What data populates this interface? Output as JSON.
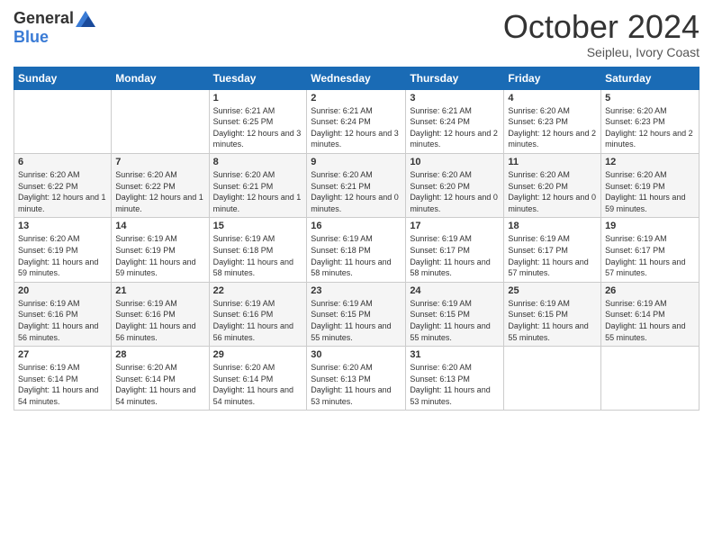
{
  "logo": {
    "general": "General",
    "blue": "Blue"
  },
  "header": {
    "title": "October 2024",
    "subtitle": "Seipleu, Ivory Coast"
  },
  "weekdays": [
    "Sunday",
    "Monday",
    "Tuesday",
    "Wednesday",
    "Thursday",
    "Friday",
    "Saturday"
  ],
  "weeks": [
    [
      null,
      null,
      {
        "day": 1,
        "sunrise": "6:21 AM",
        "sunset": "6:25 PM",
        "daylight": "12 hours and 3 minutes."
      },
      {
        "day": 2,
        "sunrise": "6:21 AM",
        "sunset": "6:24 PM",
        "daylight": "12 hours and 3 minutes."
      },
      {
        "day": 3,
        "sunrise": "6:21 AM",
        "sunset": "6:24 PM",
        "daylight": "12 hours and 2 minutes."
      },
      {
        "day": 4,
        "sunrise": "6:20 AM",
        "sunset": "6:23 PM",
        "daylight": "12 hours and 2 minutes."
      },
      {
        "day": 5,
        "sunrise": "6:20 AM",
        "sunset": "6:23 PM",
        "daylight": "12 hours and 2 minutes."
      }
    ],
    [
      {
        "day": 6,
        "sunrise": "6:20 AM",
        "sunset": "6:22 PM",
        "daylight": "12 hours and 1 minute."
      },
      {
        "day": 7,
        "sunrise": "6:20 AM",
        "sunset": "6:22 PM",
        "daylight": "12 hours and 1 minute."
      },
      {
        "day": 8,
        "sunrise": "6:20 AM",
        "sunset": "6:21 PM",
        "daylight": "12 hours and 1 minute."
      },
      {
        "day": 9,
        "sunrise": "6:20 AM",
        "sunset": "6:21 PM",
        "daylight": "12 hours and 0 minutes."
      },
      {
        "day": 10,
        "sunrise": "6:20 AM",
        "sunset": "6:20 PM",
        "daylight": "12 hours and 0 minutes."
      },
      {
        "day": 11,
        "sunrise": "6:20 AM",
        "sunset": "6:20 PM",
        "daylight": "12 hours and 0 minutes."
      },
      {
        "day": 12,
        "sunrise": "6:20 AM",
        "sunset": "6:19 PM",
        "daylight": "11 hours and 59 minutes."
      }
    ],
    [
      {
        "day": 13,
        "sunrise": "6:20 AM",
        "sunset": "6:19 PM",
        "daylight": "11 hours and 59 minutes."
      },
      {
        "day": 14,
        "sunrise": "6:19 AM",
        "sunset": "6:19 PM",
        "daylight": "11 hours and 59 minutes."
      },
      {
        "day": 15,
        "sunrise": "6:19 AM",
        "sunset": "6:18 PM",
        "daylight": "11 hours and 58 minutes."
      },
      {
        "day": 16,
        "sunrise": "6:19 AM",
        "sunset": "6:18 PM",
        "daylight": "11 hours and 58 minutes."
      },
      {
        "day": 17,
        "sunrise": "6:19 AM",
        "sunset": "6:17 PM",
        "daylight": "11 hours and 58 minutes."
      },
      {
        "day": 18,
        "sunrise": "6:19 AM",
        "sunset": "6:17 PM",
        "daylight": "11 hours and 57 minutes."
      },
      {
        "day": 19,
        "sunrise": "6:19 AM",
        "sunset": "6:17 PM",
        "daylight": "11 hours and 57 minutes."
      }
    ],
    [
      {
        "day": 20,
        "sunrise": "6:19 AM",
        "sunset": "6:16 PM",
        "daylight": "11 hours and 56 minutes."
      },
      {
        "day": 21,
        "sunrise": "6:19 AM",
        "sunset": "6:16 PM",
        "daylight": "11 hours and 56 minutes."
      },
      {
        "day": 22,
        "sunrise": "6:19 AM",
        "sunset": "6:16 PM",
        "daylight": "11 hours and 56 minutes."
      },
      {
        "day": 23,
        "sunrise": "6:19 AM",
        "sunset": "6:15 PM",
        "daylight": "11 hours and 55 minutes."
      },
      {
        "day": 24,
        "sunrise": "6:19 AM",
        "sunset": "6:15 PM",
        "daylight": "11 hours and 55 minutes."
      },
      {
        "day": 25,
        "sunrise": "6:19 AM",
        "sunset": "6:15 PM",
        "daylight": "11 hours and 55 minutes."
      },
      {
        "day": 26,
        "sunrise": "6:19 AM",
        "sunset": "6:14 PM",
        "daylight": "11 hours and 55 minutes."
      }
    ],
    [
      {
        "day": 27,
        "sunrise": "6:19 AM",
        "sunset": "6:14 PM",
        "daylight": "11 hours and 54 minutes."
      },
      {
        "day": 28,
        "sunrise": "6:20 AM",
        "sunset": "6:14 PM",
        "daylight": "11 hours and 54 minutes."
      },
      {
        "day": 29,
        "sunrise": "6:20 AM",
        "sunset": "6:14 PM",
        "daylight": "11 hours and 54 minutes."
      },
      {
        "day": 30,
        "sunrise": "6:20 AM",
        "sunset": "6:13 PM",
        "daylight": "11 hours and 53 minutes."
      },
      {
        "day": 31,
        "sunrise": "6:20 AM",
        "sunset": "6:13 PM",
        "daylight": "11 hours and 53 minutes."
      },
      null,
      null
    ]
  ]
}
